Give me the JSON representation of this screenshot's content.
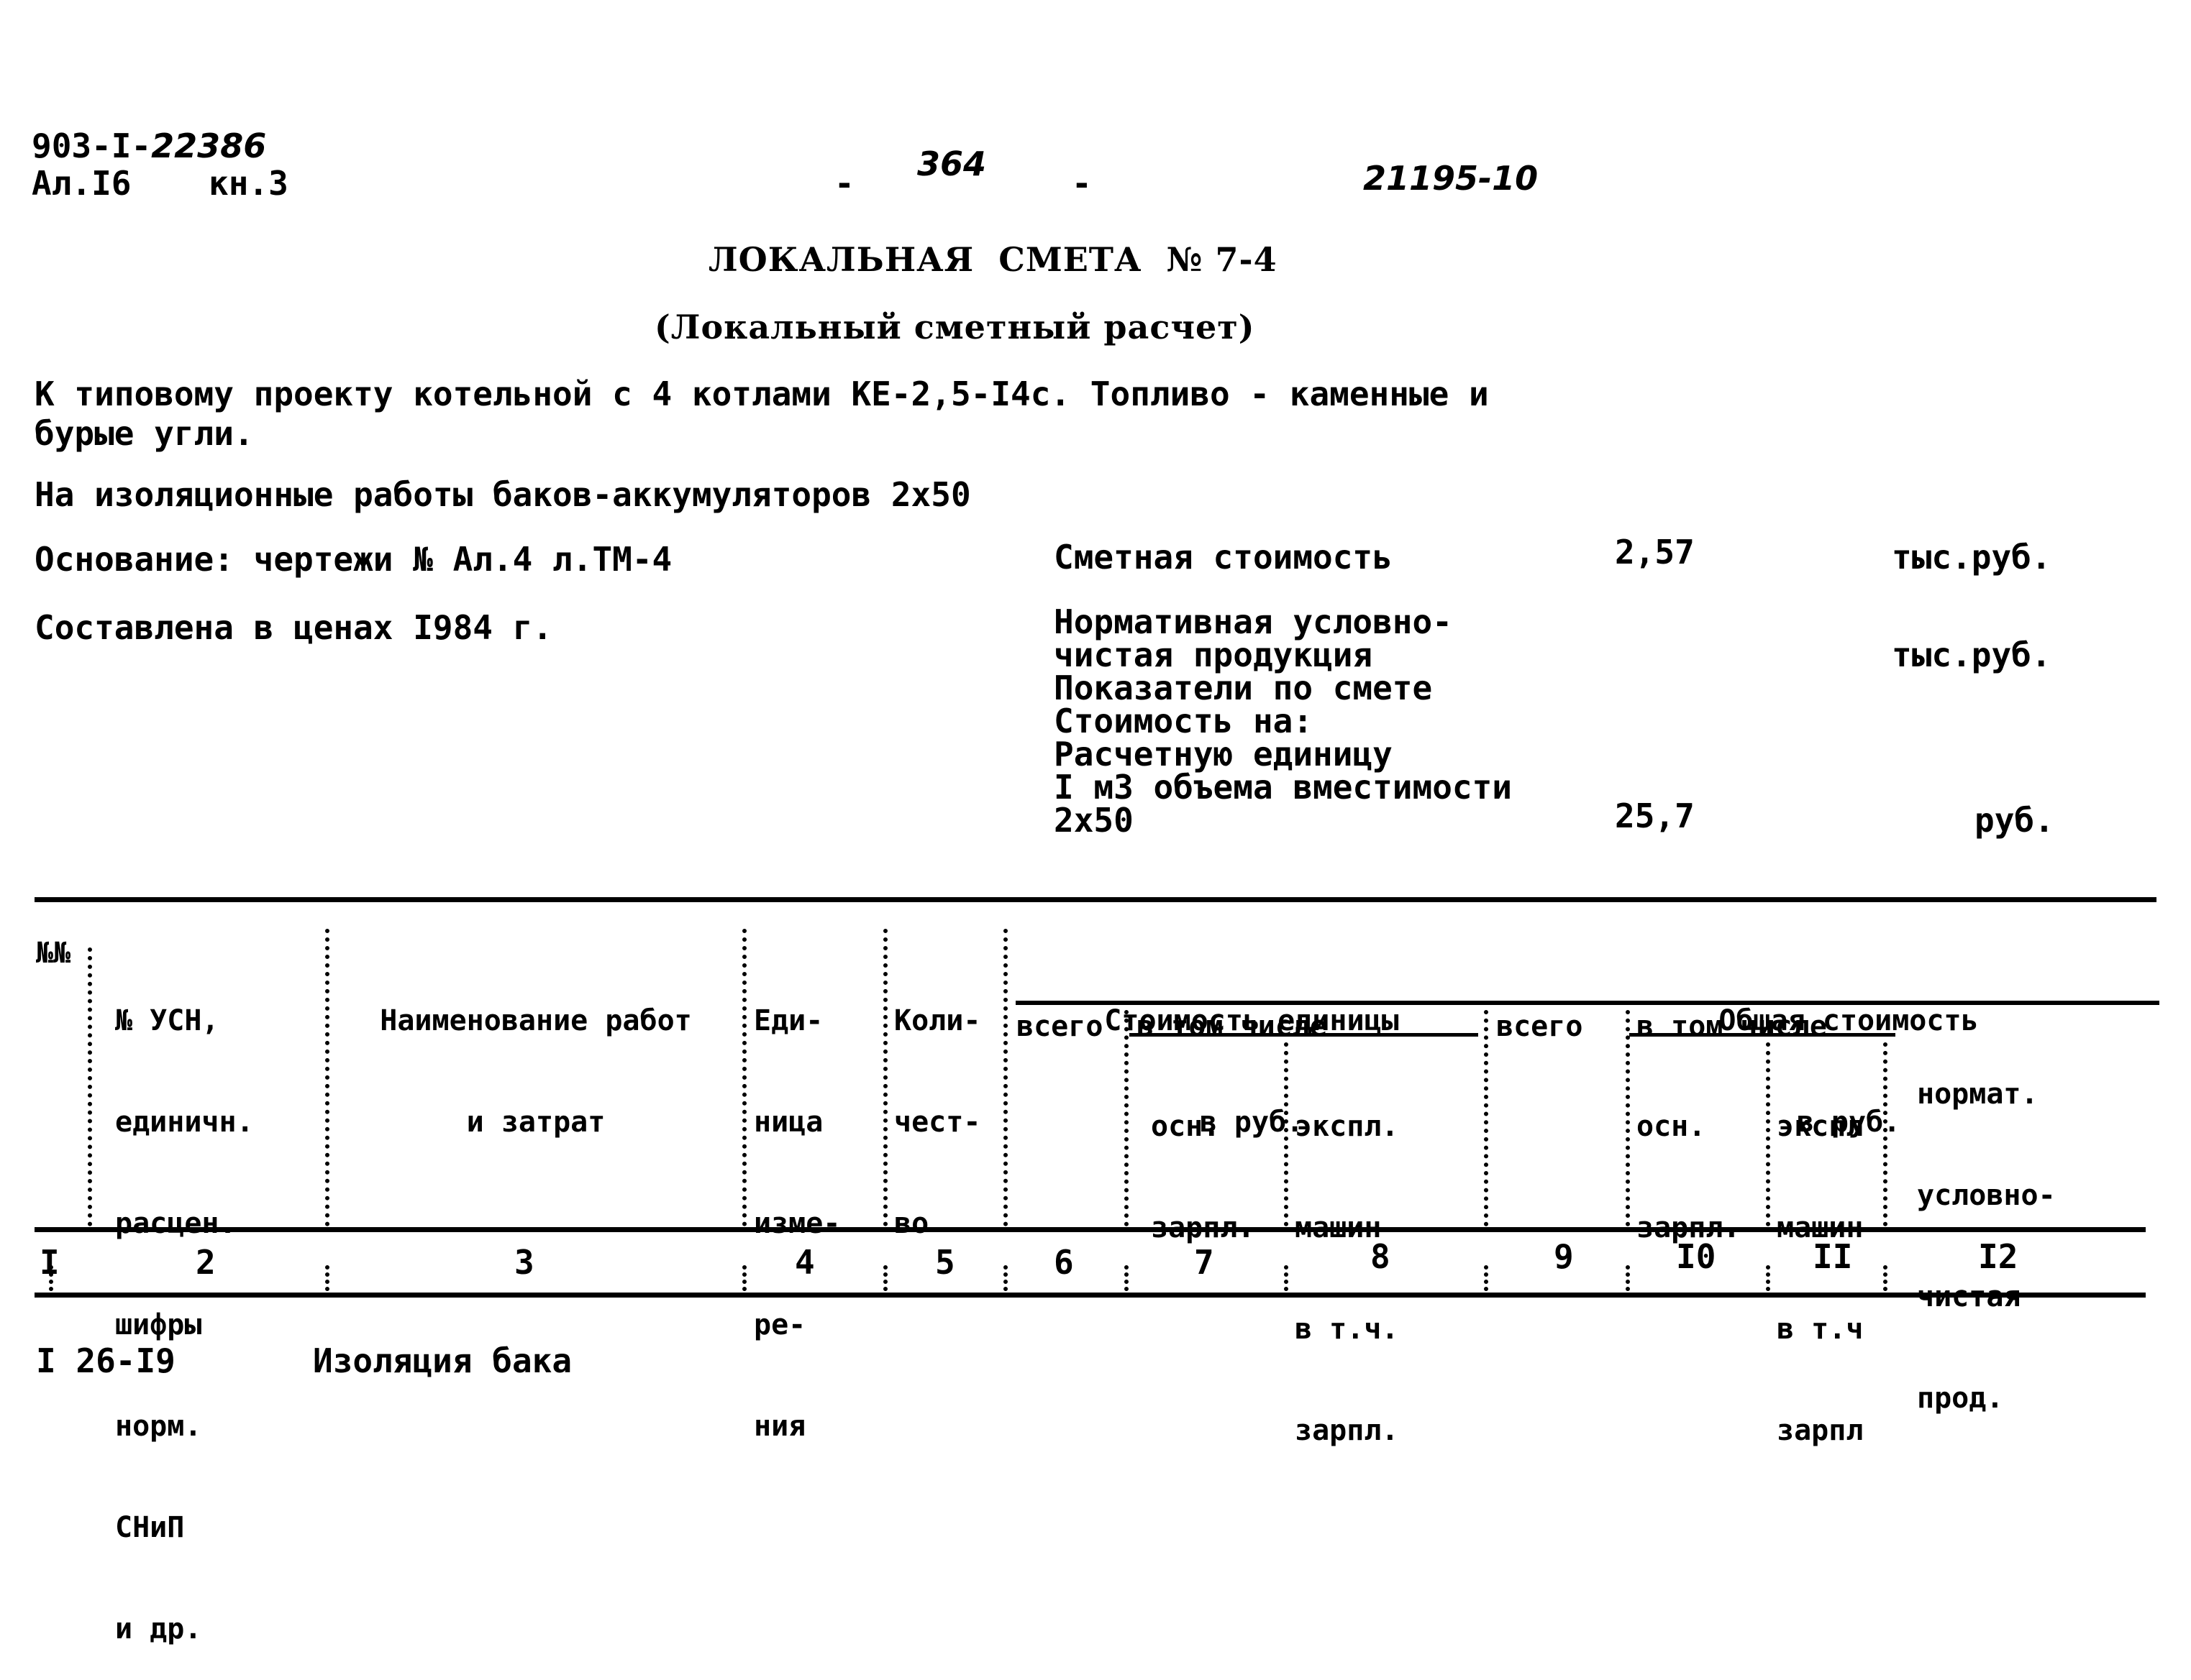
{
  "header": {
    "project_code": "903-I-",
    "project_code_handwritten": "22386",
    "album": "Ал.I6",
    "book": "кн.3",
    "page_number": "364",
    "dash": "-",
    "archive_number": "21195-10"
  },
  "document": {
    "title": "ЛОКАЛЬНАЯ  СМЕТА  № 7-4",
    "subtitle": "(Локальный сметный расчет)",
    "project_line1": "К типовому проекту котельной с 4 котлами КЕ-2,5-I4с. Топливо - каменные и",
    "project_line2": "бурые угли.",
    "work_description": "На изоляционные работы баков-аккумуляторов 2х50",
    "basis": "Основание: чертежи № Ал.4 л.ТМ-4",
    "prices": "Составлена в ценах I984 г."
  },
  "summary": {
    "estimated_cost_label": "Сметная стоимость",
    "estimated_cost_value": "2,57",
    "estimated_cost_unit": "тыс.руб.",
    "normative_label_lines": [
      "Нормативная условно-",
      "чистая продукция",
      "Показатели по смете",
      "Стоимость на:",
      "Расчетную единицу",
      "I м3 объема вместимости",
      "2х50"
    ],
    "normative_unit": "тыс.руб.",
    "unit_cost_value": "25,7",
    "unit_cost_unit": "руб."
  },
  "table": {
    "columns": [
      {
        "lines": [
          "№№"
        ]
      },
      {
        "lines": [
          "№ УСН,",
          "единичн.",
          "расцен.",
          "шифры",
          "норм.",
          "СНиП",
          "и др."
        ]
      },
      {
        "lines": [
          "Наименование работ",
          "и затрат"
        ]
      },
      {
        "lines": [
          "Еди-",
          "ница",
          "изме-",
          "ре-",
          "ния"
        ]
      },
      {
        "lines": [
          "Коли-",
          "чест-",
          "во"
        ]
      }
    ],
    "unit_cost_group": {
      "lines": [
        "Стоимость единицы",
        "в руб."
      ]
    },
    "total_cost_group": {
      "lines": [
        "Общая стоимость",
        "в руб."
      ]
    },
    "total_label": "всего",
    "incl_label": "в том числе",
    "base_salary": [
      "осн.",
      "зарпл."
    ],
    "machine_ops": [
      "экспл.",
      "машин",
      "в т.ч.",
      "зарпл."
    ],
    "machine_ops_short": [
      "экспл",
      "машин",
      "в т.ч",
      "зарпл"
    ],
    "normative_prod": [
      "нормат.",
      "условно-",
      "чистая",
      "прод."
    ],
    "column_numbers": [
      "I",
      "2",
      "3",
      "4",
      "5",
      "6",
      "7",
      "8",
      "9",
      "I0",
      "II",
      "I2"
    ]
  },
  "rows": [
    {
      "code": "I 26-I9",
      "name": "Изоляция бака"
    }
  ]
}
